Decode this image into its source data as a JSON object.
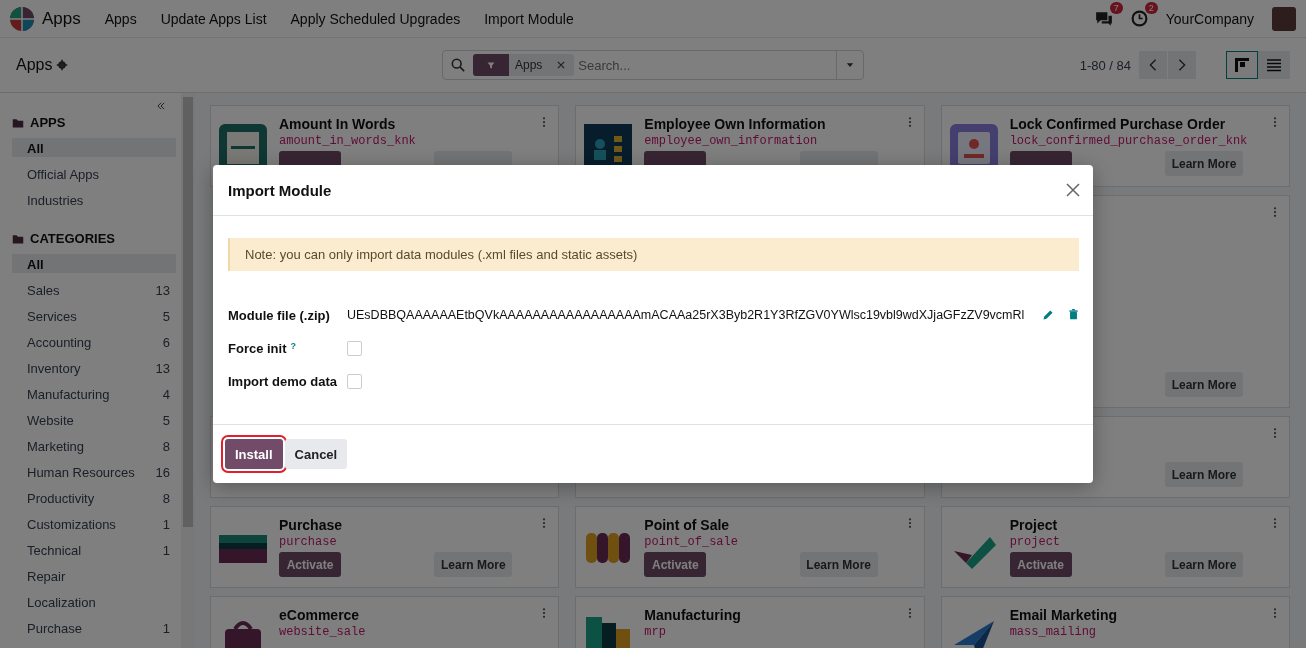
{
  "navbar": {
    "brand": "Apps",
    "menu": [
      "Apps",
      "Update Apps List",
      "Apply Scheduled Upgrades",
      "Import Module"
    ],
    "messages_count": "7",
    "activities_count": "2",
    "company": "YourCompany"
  },
  "control_panel": {
    "title": "Apps",
    "facet": "Apps",
    "search_placeholder": "Search...",
    "pager": "1-80 / 84",
    "views": [
      {
        "kind": "kanban",
        "selected": true
      },
      {
        "kind": "list",
        "selected": false
      }
    ]
  },
  "sidebar": {
    "sections": [
      {
        "title": "APPS",
        "items": [
          {
            "label": "All",
            "selected": true
          },
          {
            "label": "Official Apps",
            "selected": false
          },
          {
            "label": "Industries",
            "selected": false
          }
        ]
      },
      {
        "title": "CATEGORIES",
        "items": [
          {
            "label": "All",
            "selected": true
          },
          {
            "label": "Sales",
            "count": "13",
            "selected": false
          },
          {
            "label": "Services",
            "count": "5",
            "selected": false
          },
          {
            "label": "Accounting",
            "count": "6",
            "selected": false
          },
          {
            "label": "Inventory",
            "count": "13",
            "selected": false
          },
          {
            "label": "Manufacturing",
            "count": "4",
            "selected": false
          },
          {
            "label": "Website",
            "count": "5",
            "selected": false
          },
          {
            "label": "Marketing",
            "count": "8",
            "selected": false
          },
          {
            "label": "Human Resources",
            "count": "16",
            "selected": false
          },
          {
            "label": "Productivity",
            "count": "8",
            "selected": false
          },
          {
            "label": "Customizations",
            "count": "1",
            "selected": false
          },
          {
            "label": "Technical",
            "count": "1",
            "selected": false
          },
          {
            "label": "Repair",
            "selected": false
          },
          {
            "label": "Localization",
            "selected": false
          },
          {
            "label": "Purchase",
            "count": "1",
            "selected": false
          }
        ]
      }
    ]
  },
  "cards": [
    {
      "kind": "app",
      "name": "Amount In Words",
      "code": "amount_in_words_knk",
      "buttons": [
        {
          "kind": "activate"
        },
        {
          "kind": "learn"
        }
      ]
    },
    {
      "kind": "app",
      "name": "Employee Own Information",
      "code": "employee_own_information",
      "buttons": [
        {
          "kind": "activate"
        },
        {
          "kind": "learn"
        }
      ]
    },
    {
      "kind": "app",
      "name": "Lock Confirmed Purchase Order",
      "code": "lock_confirmed_purchase_order_knk",
      "buttons": [
        {
          "kind": "activate"
        },
        {
          "kind": "learn",
          "label": "Learn More"
        }
      ]
    },
    {
      "kind": "app",
      "buttons": [
        {
          "kind": "learn",
          "label": "Learn More"
        }
      ]
    },
    {
      "kind": "app",
      "buttons": [
        {
          "kind": "learn",
          "label": "Learn More"
        }
      ]
    },
    {
      "kind": "app",
      "name": "Purchase",
      "code": "purchase",
      "buttons": [
        {
          "kind": "activate",
          "label": "Activate"
        },
        {
          "kind": "learn",
          "label": "Learn More"
        }
      ]
    },
    {
      "kind": "app",
      "name": "Point of Sale",
      "code": "point_of_sale",
      "buttons": [
        {
          "kind": "activate",
          "label": "Activate"
        },
        {
          "kind": "learn",
          "label": "Learn More"
        }
      ]
    },
    {
      "kind": "app",
      "name": "Project",
      "code": "project",
      "buttons": [
        {
          "kind": "activate",
          "label": "Activate"
        },
        {
          "kind": "learn",
          "label": "Learn More"
        }
      ]
    },
    {
      "kind": "app",
      "name": "eCommerce",
      "code": "website_sale"
    },
    {
      "kind": "app",
      "name": "Manufacturing",
      "code": "mrp"
    },
    {
      "kind": "app",
      "name": "Email Marketing",
      "code": "mass_mailing"
    }
  ],
  "dialog": {
    "title": "Import Module",
    "note": "Note: you can only import data modules (.xml files and static assets)",
    "fields": [
      {
        "kind": "file",
        "label": "Module file (.zip)",
        "value": "UEsDBBQAAAAAAEtbQVkAAAAAAAAAAAAAAAAAmACAAa25rX3Byb2R1Y3RfZGV0YWlsc19vbl9wdXJjaGFzZV9vcmRl"
      },
      {
        "kind": "checkbox",
        "label": "Force init",
        "help": "?",
        "checked": false
      },
      {
        "kind": "checkbox",
        "label": "Import demo data",
        "checked": false
      }
    ],
    "buttons": [
      {
        "kind": "primary",
        "label": "Install",
        "highlighted": true
      },
      {
        "kind": "secondary",
        "label": "Cancel",
        "highlighted": false
      }
    ]
  }
}
